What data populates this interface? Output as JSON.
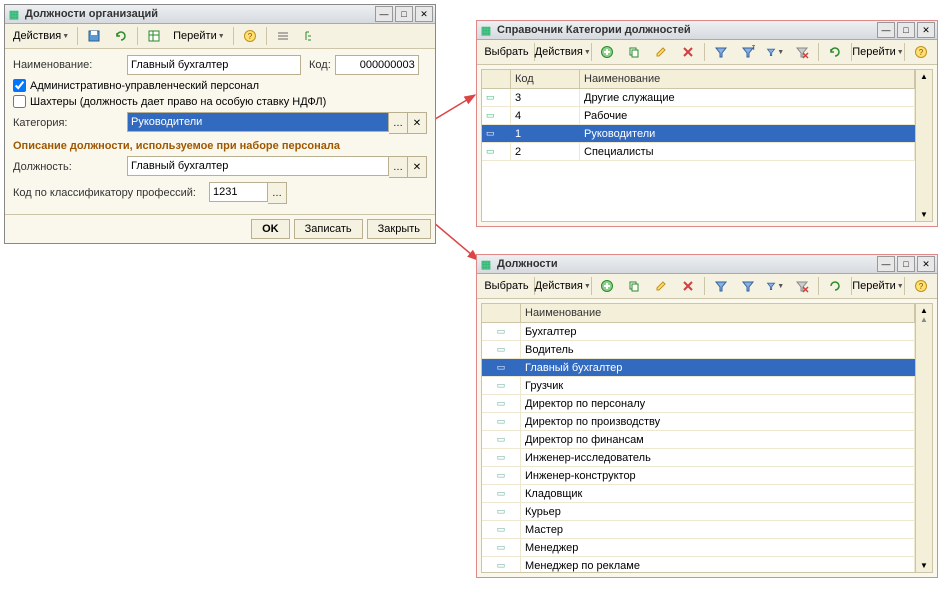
{
  "win1": {
    "title": "Должности организаций",
    "tb": {
      "actions": "Действия",
      "goto": "Перейти"
    },
    "form": {
      "name_lbl": "Наименование:",
      "name_val": "Главный бухгалтер",
      "code_lbl": "Код:",
      "code_val": "000000003",
      "chk1": "Административно-управленческий персонал",
      "chk2": "Шахтеры (должность дает право на особую ставку НДФЛ)",
      "cat_lbl": "Категория:",
      "cat_val": "Руководители",
      "section": "Описание должности, используемое при наборе персонала",
      "pos_lbl": "Должность:",
      "pos_val": "Главный бухгалтер",
      "class_lbl": "Код по классификатору профессий:",
      "class_val": "1231"
    },
    "footer": {
      "ok": "OK",
      "save": "Записать",
      "close": "Закрыть"
    }
  },
  "win2": {
    "title": "Справочник Категории должностей",
    "tb": {
      "select": "Выбрать",
      "actions": "Действия",
      "goto": "Перейти"
    },
    "cols": {
      "code": "Код",
      "name": "Наименование"
    },
    "rows": [
      {
        "code": "3",
        "name": "Другие служащие"
      },
      {
        "code": "4",
        "name": "Рабочие"
      },
      {
        "code": "1",
        "name": "Руководители"
      },
      {
        "code": "2",
        "name": "Специалисты"
      }
    ]
  },
  "win3": {
    "title": "Должности",
    "tb": {
      "select": "Выбрать",
      "actions": "Действия",
      "goto": "Перейти"
    },
    "cols": {
      "name": "Наименование"
    },
    "rows": [
      {
        "name": "Бухгалтер"
      },
      {
        "name": "Водитель"
      },
      {
        "name": "Главный бухгалтер"
      },
      {
        "name": "Грузчик"
      },
      {
        "name": "Директор по персоналу"
      },
      {
        "name": "Директор по производству"
      },
      {
        "name": "Директор по финансам"
      },
      {
        "name": "Инженер-исследователь"
      },
      {
        "name": "Инженер-конструктор"
      },
      {
        "name": "Кладовщик"
      },
      {
        "name": "Курьер"
      },
      {
        "name": "Мастер"
      },
      {
        "name": "Менеджер"
      },
      {
        "name": "Менеджер по рекламе"
      }
    ]
  }
}
